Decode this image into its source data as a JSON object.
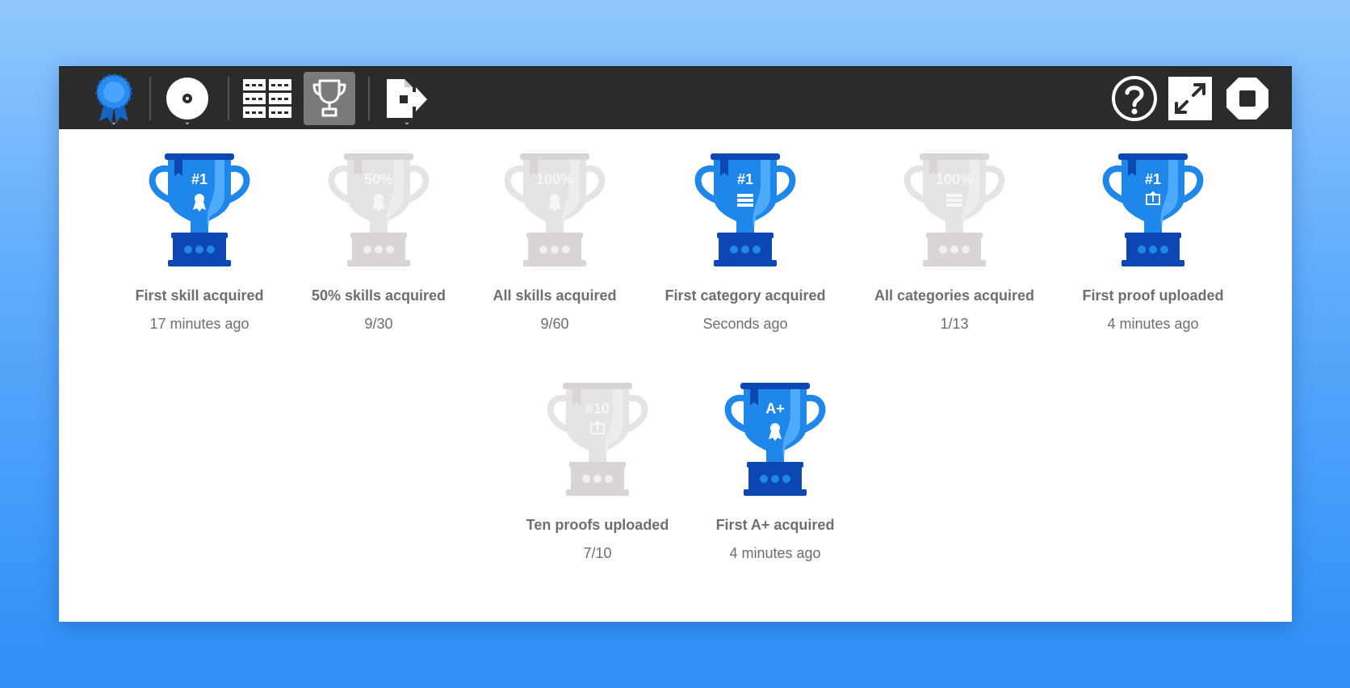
{
  "colors": {
    "earned_cup": "#1f87ea",
    "earned_dark": "#0d47b3",
    "earned_light": "#5fb6ff",
    "locked_cup": "#e6e3e3",
    "locked_dark": "#d9d5d5",
    "locked_light": "#f1efef",
    "toolbar_bg": "#2b2b2b",
    "active_tool_bg": "#7a7a7a",
    "caption_text": "#6e6e6e"
  },
  "toolbar": {
    "left_tools": [
      {
        "name": "badge-menu",
        "icon": "award-ribbon-icon",
        "has_dropdown": true,
        "active": false
      },
      {
        "name": "disc-menu",
        "icon": "disc-icon",
        "has_dropdown": true,
        "active": false
      },
      {
        "name": "categories-view",
        "icon": "grid-view-icon",
        "has_dropdown": false,
        "active": false
      },
      {
        "name": "achievements-view",
        "icon": "trophy-icon",
        "has_dropdown": false,
        "active": true
      },
      {
        "name": "export-menu",
        "icon": "export-file-icon",
        "has_dropdown": true,
        "active": false
      }
    ],
    "right_tools": [
      {
        "name": "help",
        "icon": "help-circle-icon"
      },
      {
        "name": "fullscreen",
        "icon": "expand-icon"
      },
      {
        "name": "stop",
        "icon": "stop-octagon-icon"
      }
    ],
    "caret_glyph": "⌄"
  },
  "achievements": [
    {
      "id": "first-skill",
      "title": "First skill acquired",
      "subtitle": "17 minutes ago",
      "badge": "#1",
      "emblem": "ribbon",
      "earned": true
    },
    {
      "id": "half-skills",
      "title": "50% skills acquired",
      "subtitle": "9/30",
      "badge": "50%",
      "emblem": "ribbon",
      "earned": false
    },
    {
      "id": "all-skills",
      "title": "All skills acquired",
      "subtitle": "9/60",
      "badge": "100%",
      "emblem": "ribbon",
      "earned": false
    },
    {
      "id": "first-category",
      "title": "First category acquired",
      "subtitle": "Seconds ago",
      "badge": "#1",
      "emblem": "grid",
      "earned": true
    },
    {
      "id": "all-categories",
      "title": "All categories acquired",
      "subtitle": "1/13",
      "badge": "100%",
      "emblem": "grid",
      "earned": false
    },
    {
      "id": "first-proof",
      "title": "First proof uploaded",
      "subtitle": "4 minutes ago",
      "badge": "#1",
      "emblem": "upload",
      "earned": true
    },
    {
      "id": "ten-proofs",
      "title": "Ten proofs uploaded",
      "subtitle": "7/10",
      "badge": "#10",
      "emblem": "upload",
      "earned": false
    },
    {
      "id": "first-a-plus",
      "title": "First A+ acquired",
      "subtitle": "4 minutes ago",
      "badge": "A+",
      "emblem": "ribbon",
      "earned": true
    }
  ]
}
